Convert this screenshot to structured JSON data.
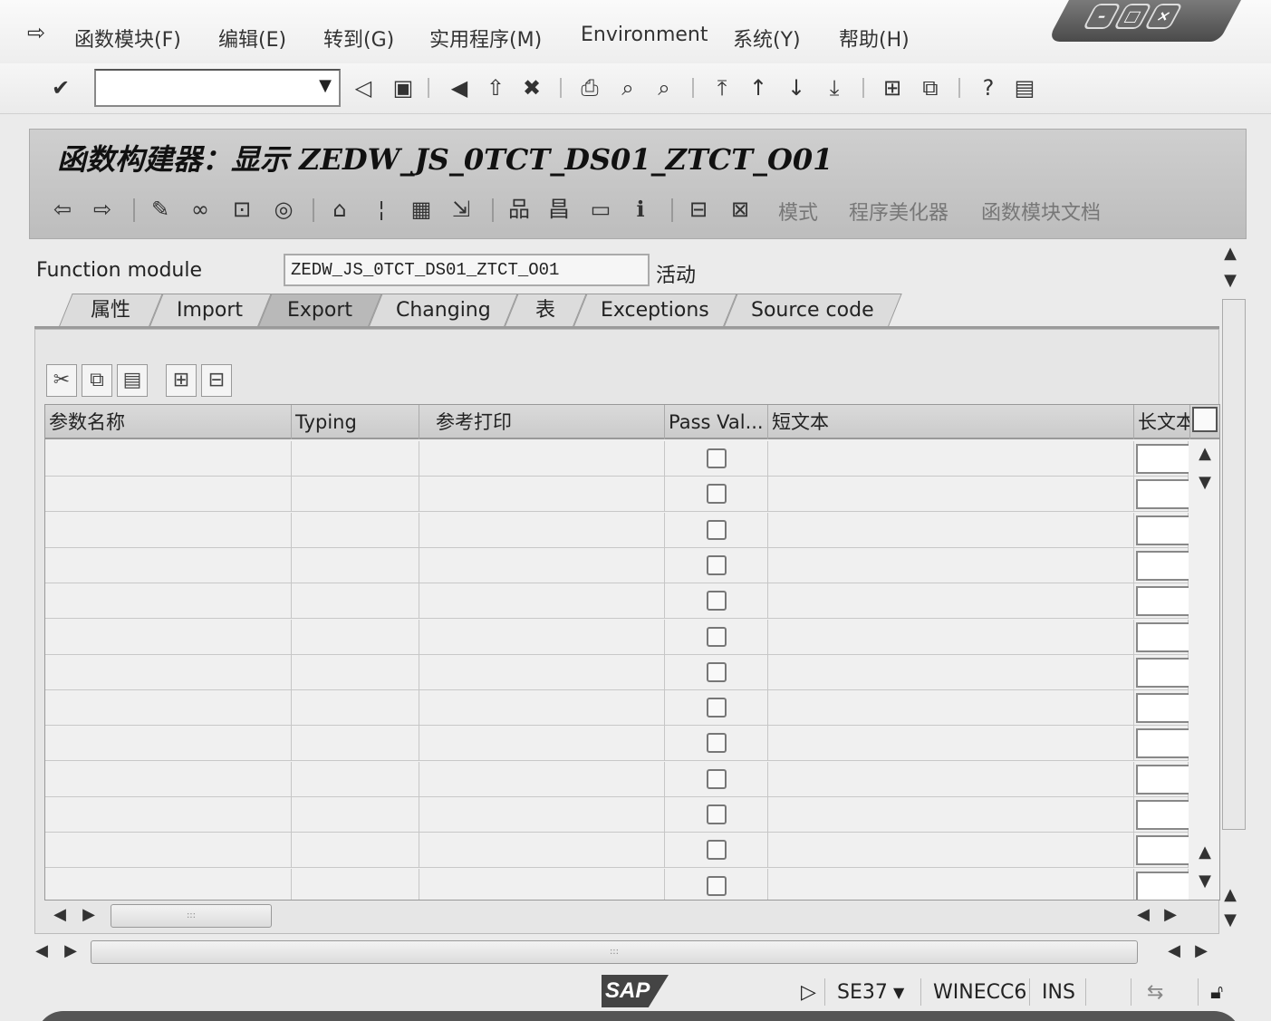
{
  "menu": {
    "items": [
      {
        "label": "函数模块(F)"
      },
      {
        "label": "编辑(E)"
      },
      {
        "label": "转到(G)"
      },
      {
        "label": "实用程序(M)"
      },
      {
        "label": "Environment"
      },
      {
        "label": "系统(Y)"
      },
      {
        "label": "帮助(H)"
      }
    ]
  },
  "command_field": {
    "value": ""
  },
  "page": {
    "title": "函数构建器：显示 ZEDW_JS_0TCT_DS01_ZTCT_O01"
  },
  "app_toolbar": {
    "text_buttons": [
      "模式",
      "程序美化器",
      "函数模块文档"
    ]
  },
  "function_module": {
    "label": "Function module",
    "value": "ZEDW_JS_0TCT_DS01_ZTCT_O01",
    "status": "活动"
  },
  "tabs": [
    {
      "label": "属性"
    },
    {
      "label": "Import"
    },
    {
      "label": "Export",
      "active": true
    },
    {
      "label": "Changing"
    },
    {
      "label": "表"
    },
    {
      "label": "Exceptions"
    },
    {
      "label": "Source code"
    }
  ],
  "table": {
    "columns": [
      "参数名称",
      "Typing",
      "参考打印",
      "Pass Val...",
      "短文本",
      "长文本"
    ],
    "rows": [
      {
        "param": "",
        "typing": "",
        "ref": "",
        "pass_value": false,
        "short_text": ""
      },
      {
        "param": "",
        "typing": "",
        "ref": "",
        "pass_value": false,
        "short_text": ""
      },
      {
        "param": "",
        "typing": "",
        "ref": "",
        "pass_value": false,
        "short_text": ""
      },
      {
        "param": "",
        "typing": "",
        "ref": "",
        "pass_value": false,
        "short_text": ""
      },
      {
        "param": "",
        "typing": "",
        "ref": "",
        "pass_value": false,
        "short_text": ""
      },
      {
        "param": "",
        "typing": "",
        "ref": "",
        "pass_value": false,
        "short_text": ""
      },
      {
        "param": "",
        "typing": "",
        "ref": "",
        "pass_value": false,
        "short_text": ""
      },
      {
        "param": "",
        "typing": "",
        "ref": "",
        "pass_value": false,
        "short_text": ""
      },
      {
        "param": "",
        "typing": "",
        "ref": "",
        "pass_value": false,
        "short_text": ""
      },
      {
        "param": "",
        "typing": "",
        "ref": "",
        "pass_value": false,
        "short_text": ""
      },
      {
        "param": "",
        "typing": "",
        "ref": "",
        "pass_value": false,
        "short_text": ""
      },
      {
        "param": "",
        "typing": "",
        "ref": "",
        "pass_value": false,
        "short_text": ""
      },
      {
        "param": "",
        "typing": "",
        "ref": "",
        "pass_value": false,
        "short_text": ""
      }
    ]
  },
  "status": {
    "logo": "SAP",
    "transaction": "SE37",
    "system": "WINECC6",
    "mode": "INS"
  }
}
